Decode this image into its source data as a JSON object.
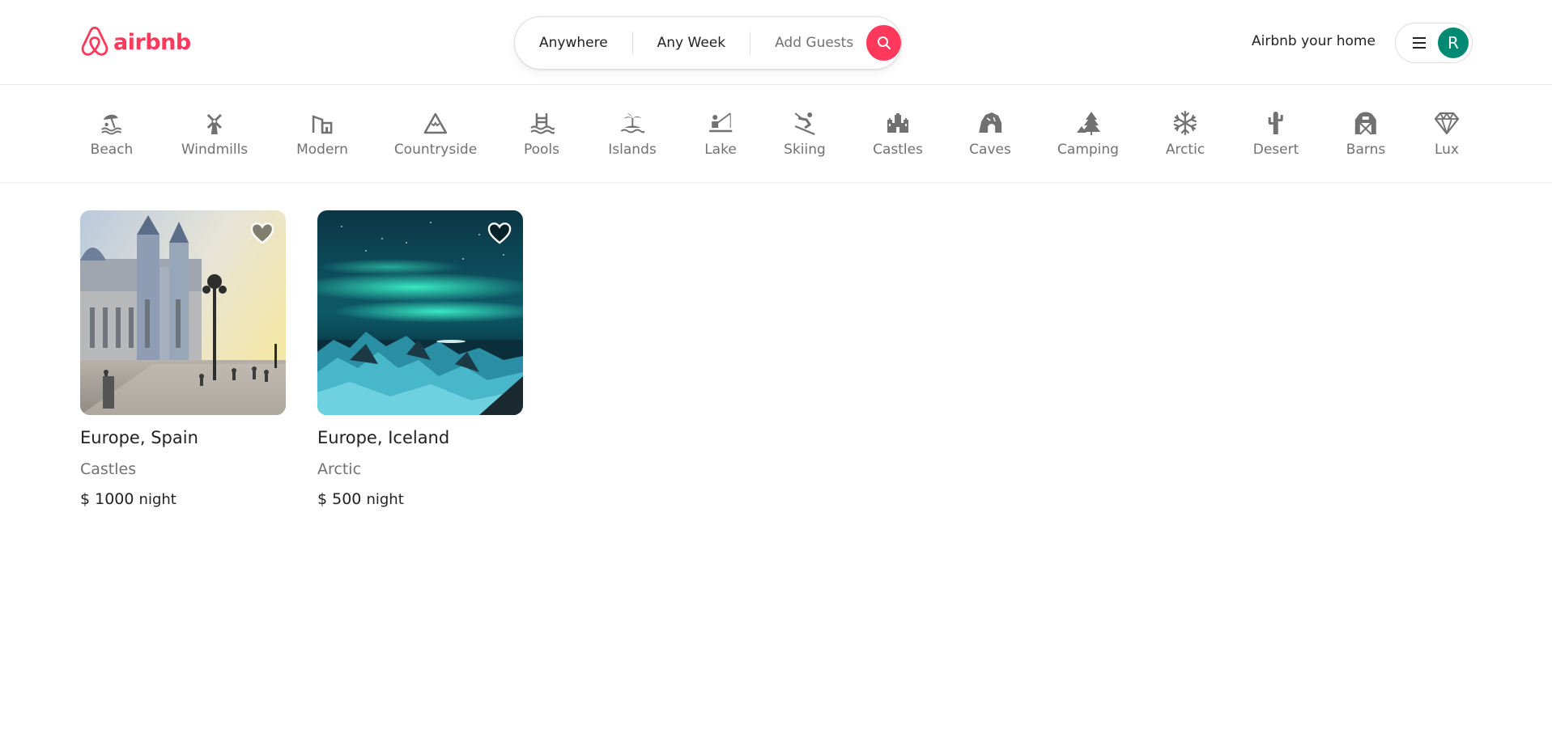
{
  "brand": {
    "name": "airbnb",
    "color": "#ff385c"
  },
  "search": {
    "location": "Anywhere",
    "dates": "Any Week",
    "guests": "Add Guests",
    "button_color": "#ff385c"
  },
  "nav": {
    "host_link": "Airbnb your home",
    "avatar_initial": "R",
    "avatar_color": "#008a73"
  },
  "categories": [
    {
      "label": "Beach",
      "icon": "beach-icon"
    },
    {
      "label": "Windmills",
      "icon": "windmill-icon"
    },
    {
      "label": "Modern",
      "icon": "modern-house-icon"
    },
    {
      "label": "Countryside",
      "icon": "mountain-icon"
    },
    {
      "label": "Pools",
      "icon": "pool-icon"
    },
    {
      "label": "Islands",
      "icon": "island-icon"
    },
    {
      "label": "Lake",
      "icon": "lake-icon"
    },
    {
      "label": "Skiing",
      "icon": "skiing-icon"
    },
    {
      "label": "Castles",
      "icon": "castle-icon"
    },
    {
      "label": "Caves",
      "icon": "cave-icon"
    },
    {
      "label": "Camping",
      "icon": "camping-icon"
    },
    {
      "label": "Arctic",
      "icon": "snowflake-icon"
    },
    {
      "label": "Desert",
      "icon": "cactus-icon"
    },
    {
      "label": "Barns",
      "icon": "barn-icon"
    },
    {
      "label": "Lux",
      "icon": "diamond-icon"
    }
  ],
  "listings": [
    {
      "title": "Europe, Spain",
      "category": "Castles",
      "price": "$ 1000",
      "unit": "night"
    },
    {
      "title": "Europe, Iceland",
      "category": "Arctic",
      "price": "$ 500",
      "unit": "night"
    }
  ]
}
